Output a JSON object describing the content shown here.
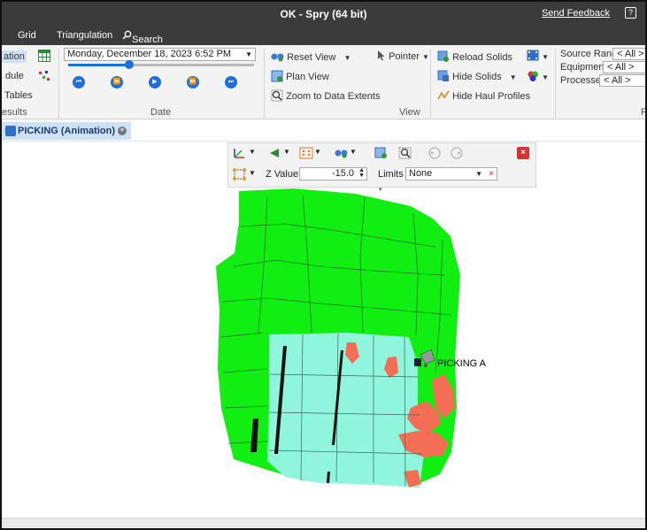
{
  "window": {
    "title": "OK - Spry (64 bit)",
    "send_feedback": "Send Feedback",
    "help_glyph": "?"
  },
  "menu": {
    "grid": "Grid",
    "triangulation": "Triangulation",
    "search": "Search"
  },
  "ribbon": {
    "results_group": {
      "items": [
        "ation",
        "dule",
        "Tables"
      ],
      "label": "esults"
    },
    "date_group": {
      "date_value": "Monday, December 18, 2023 6:52 PM",
      "slider_fraction": 0.33,
      "label": "Date"
    },
    "view_group": {
      "reset_view": "Reset View",
      "plan_view": "Plan View",
      "zoom_to_extents": "Zoom to Data Extents",
      "pointer": "Pointer",
      "label": "View"
    },
    "solids_group": {
      "reload_solids": "Reload Solids",
      "hide_solids": "Hide Solids",
      "hide_haul_profiles": "Hide Haul Profiles"
    },
    "filters_group": {
      "source_range_label": "Source Range",
      "source_range_value": "< All >",
      "equipment_label": "Equipment",
      "equipment_value": "< All >",
      "processes_label": "Processes",
      "processes_value": "< All >",
      "label_clipped": "F"
    }
  },
  "tabs": [
    {
      "label": "PICKING (Animation)",
      "close": "×"
    }
  ],
  "toolbox": {
    "z_value_label": "Z Value",
    "z_value": "-15.0",
    "limits_label": "Limits",
    "limits_value": "None",
    "clear_glyph": "×",
    "close_glyph": "×"
  },
  "viewport": {
    "equipment_label": "PICKING A",
    "colors": {
      "surface_green": "#11ee11",
      "surface_cyan": "#8ff5dc",
      "highlight_red": "#f46e55",
      "contour_line": "#1a7a1a"
    }
  }
}
